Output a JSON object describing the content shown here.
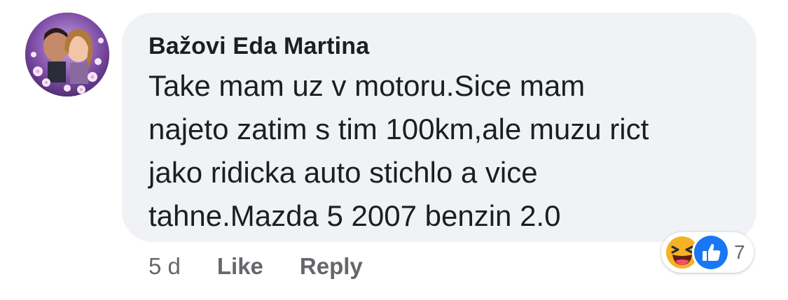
{
  "comment": {
    "author": "Bažovi Eda Martina",
    "text": "Take mam uz v motoru.Sice mam\nnajeto zatim s tim 100km,ale muzu rict\njako ridicka auto stichlo a vice\ntahne.Mazda 5 2007 benzin 2.0",
    "timestamp": "5 d",
    "like_label": "Like",
    "reply_label": "Reply",
    "reactions": {
      "icons": [
        "laughing-emoji-icon",
        "thumbs-up-icon"
      ],
      "count": "7"
    }
  },
  "colors": {
    "bubble_bg": "#f0f2f5",
    "meta_text": "#65676b",
    "like_blue": "#1877f2",
    "haha_yellow": "#f7b125"
  }
}
